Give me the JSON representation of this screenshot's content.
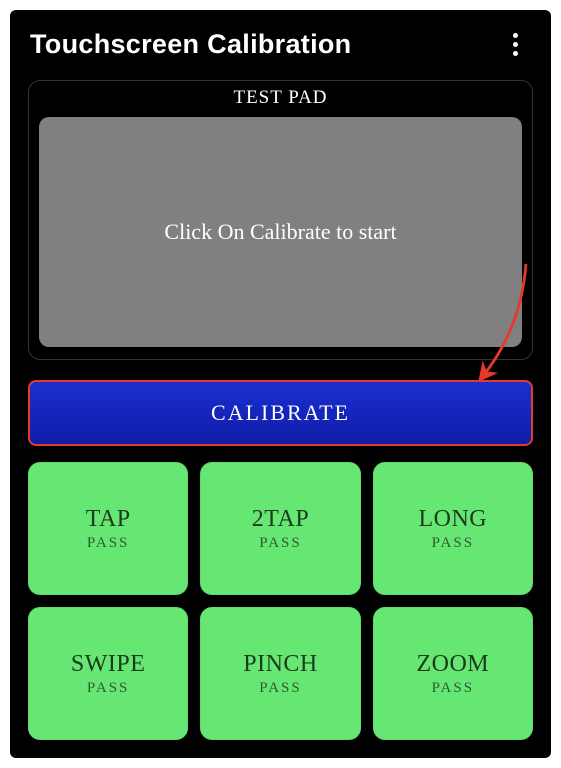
{
  "header": {
    "title": "Touchscreen Calibration"
  },
  "testpad": {
    "label": "TEST PAD",
    "message": "Click On Calibrate to start"
  },
  "calibrate": {
    "label": "CALIBRATE"
  },
  "tests": [
    {
      "name": "TAP",
      "status": "PASS"
    },
    {
      "name": "2TAP",
      "status": "PASS"
    },
    {
      "name": "LONG",
      "status": "PASS"
    },
    {
      "name": "SWIPE",
      "status": "PASS"
    },
    {
      "name": "PINCH",
      "status": "PASS"
    },
    {
      "name": "ZOOM",
      "status": "PASS"
    }
  ],
  "colors": {
    "accent_green": "#66e673",
    "accent_blue": "#1422b8",
    "highlight_red": "#e53a2a"
  }
}
